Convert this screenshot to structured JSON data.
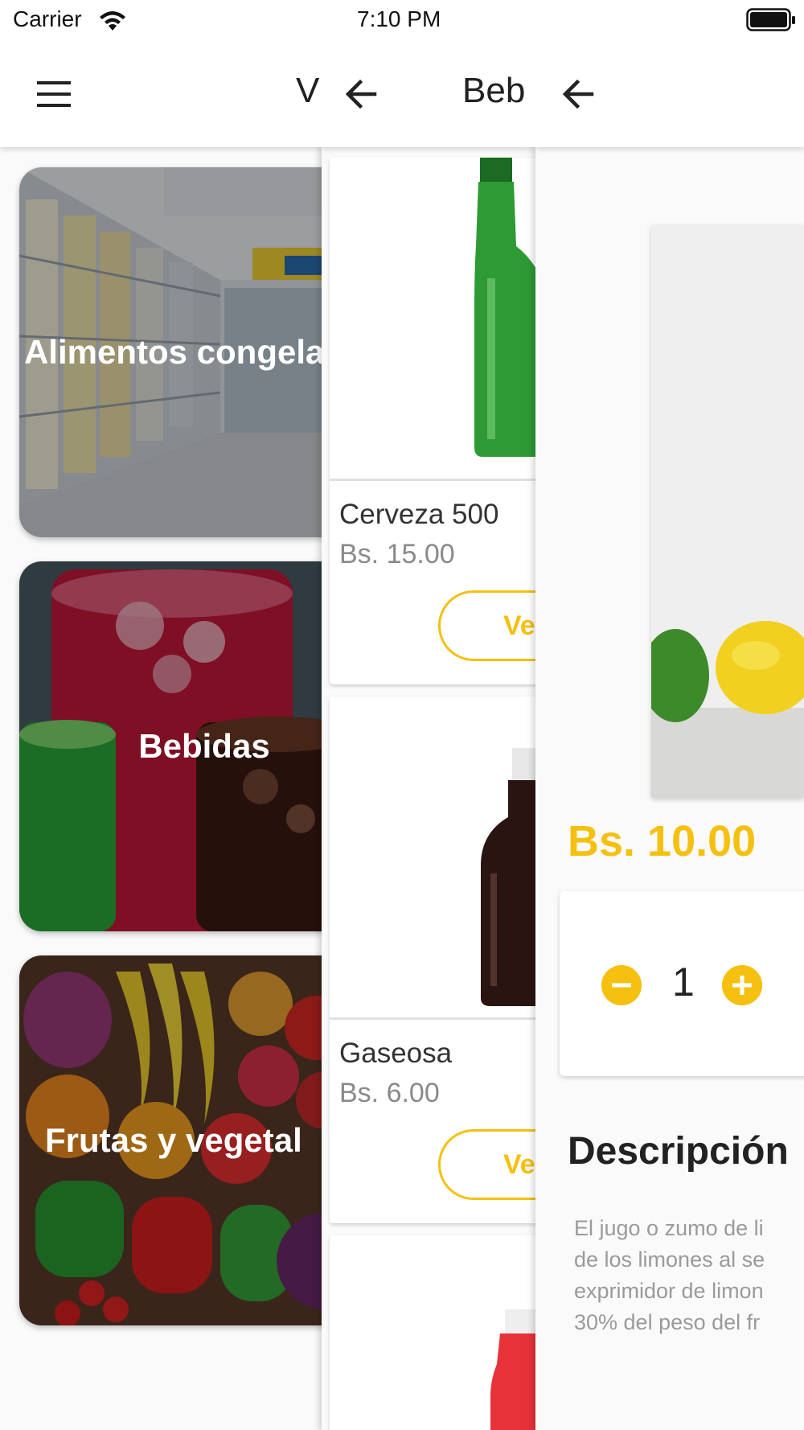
{
  "status_bar": {
    "carrier": "Carrier",
    "time": "7:10 PM"
  },
  "panel_categories": {
    "title": "V",
    "menu_icon": "menu-icon",
    "categories": [
      {
        "label": "Alimentos congelados"
      },
      {
        "label": "Bebidas"
      },
      {
        "label": "Frutas y vegetal"
      }
    ]
  },
  "panel_products": {
    "title": "Beb",
    "back_icon": "arrow-left-icon",
    "products": [
      {
        "name": "Cerveza 500",
        "price": "Bs. 15.00",
        "button": "Ve"
      },
      {
        "name": "Gaseosa",
        "price": "Bs. 6.00",
        "button": "Ve"
      }
    ]
  },
  "panel_detail": {
    "back_icon": "arrow-left-icon",
    "price": "Bs. 10.00",
    "quantity": "1",
    "description_title": "Descripción",
    "description_lines": [
      "El jugo o zumo de li",
      "de los limones al se",
      "exprimidor de limon",
      "30% del peso del fr"
    ]
  },
  "colors": {
    "accent": "#f5c010",
    "text": "#212121",
    "muted": "#8a8a8a"
  }
}
